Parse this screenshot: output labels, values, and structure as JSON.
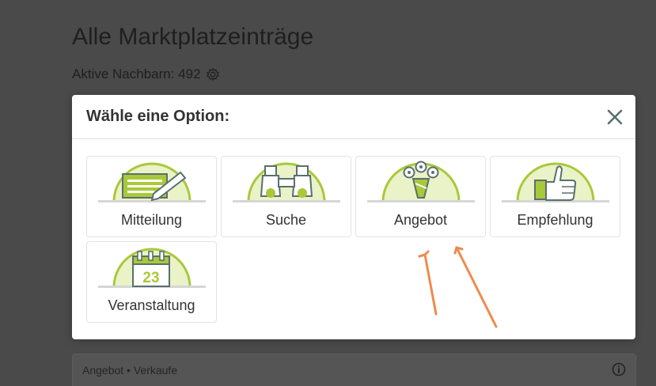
{
  "page": {
    "title": "Alle Marktplatzeinträge",
    "neighbors_label": "Aktive Nachbarn: 492",
    "settings_icon": "gear-icon"
  },
  "modal": {
    "title": "Wähle eine Option:",
    "close_icon": "close-icon",
    "options": [
      {
        "label": "Mitteilung",
        "icon": "notepad-pencil-icon"
      },
      {
        "label": "Suche",
        "icon": "binoculars-icon"
      },
      {
        "label": "Angebot",
        "icon": "flower-bouquet-icon"
      },
      {
        "label": "Empfehlung",
        "icon": "thumbs-up-icon"
      },
      {
        "label": "Veranstaltung",
        "icon": "calendar-icon",
        "calendar_day": "23"
      }
    ]
  },
  "background_listing": {
    "label": "Angebot • Verkaufe",
    "info_icon": "info-icon"
  },
  "annotation": {
    "arrow_color": "#f08a4b"
  },
  "colors": {
    "icon_green": "#a8c93a",
    "icon_green_light": "#eaf2c8",
    "overlay": "#4a4a4a"
  }
}
